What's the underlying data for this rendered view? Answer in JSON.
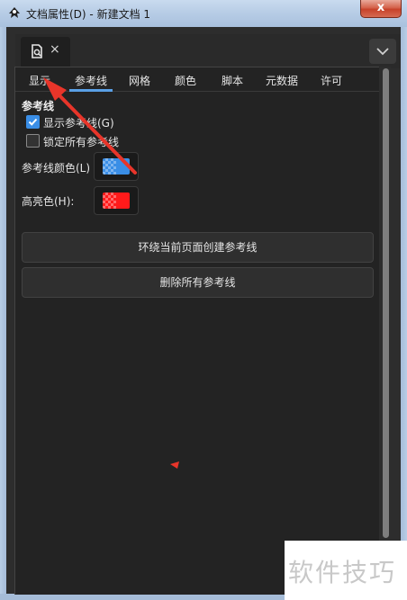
{
  "window": {
    "title": "文档属性(D) - 新建文档 1",
    "close_label": "x"
  },
  "doc_tab": {
    "close_label": "×"
  },
  "tabs": [
    {
      "label": "显示"
    },
    {
      "label": "参考线"
    },
    {
      "label": "网格"
    },
    {
      "label": "颜色"
    },
    {
      "label": "脚本"
    },
    {
      "label": "元数据"
    },
    {
      "label": "许可"
    }
  ],
  "active_tab": "参考线",
  "guides": {
    "section_title": "参考线",
    "show_guides": {
      "label": "显示参考线(G)",
      "checked": true
    },
    "lock_guides": {
      "label": "锁定所有参考线",
      "checked": false
    },
    "guide_color": {
      "label": "参考线颜色(L)",
      "color": "#3a8ee6"
    },
    "highlight_color": {
      "label": "高亮色(H):",
      "color": "#ff1a1a"
    },
    "create_around_page_button": "环绕当前页面创建参考线",
    "delete_all_button": "删除所有参考线"
  },
  "colors": {
    "accent": "#5aa0e6",
    "annotation_arrow": "#e8352a"
  },
  "watermark": {
    "text": "软件技巧"
  }
}
